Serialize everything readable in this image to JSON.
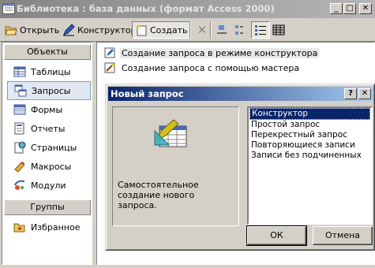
{
  "window": {
    "title": "Библиотека : база данных (формат Access 2000)"
  },
  "toolbar": {
    "open_label": "Открыть",
    "design_label": "Конструктор",
    "create_label": "Создать"
  },
  "objects_bar": {
    "header": "Объекты",
    "items": [
      {
        "label": "Таблицы",
        "icon": "table-icon"
      },
      {
        "label": "Запросы",
        "icon": "query-icon"
      },
      {
        "label": "Формы",
        "icon": "form-icon"
      },
      {
        "label": "Отчеты",
        "icon": "report-icon"
      },
      {
        "label": "Страницы",
        "icon": "page-icon"
      },
      {
        "label": "Макросы",
        "icon": "macro-icon"
      },
      {
        "label": "Модули",
        "icon": "module-icon"
      }
    ],
    "groups_header": "Группы",
    "favorites_label": "Избранное"
  },
  "list": {
    "items": [
      {
        "label": "Создание запроса в режиме конструктора"
      },
      {
        "label": "Создание запроса с помощью мастера"
      }
    ]
  },
  "dialog": {
    "title": "Новый запрос",
    "description": "Самостоятельное создание нового запроса.",
    "options": [
      "Конструктор",
      "Простой запрос",
      "Перекрестный запрос",
      "Повторяющиеся записи",
      "Записи без подчиненных"
    ],
    "selected": "Конструктор",
    "ok_label": "ОК",
    "cancel_label": "Отмена"
  },
  "colors": {
    "dialog_title_start": "#0a246a",
    "dialog_title_end": "#a6caf0",
    "selection": "#0a246a"
  }
}
